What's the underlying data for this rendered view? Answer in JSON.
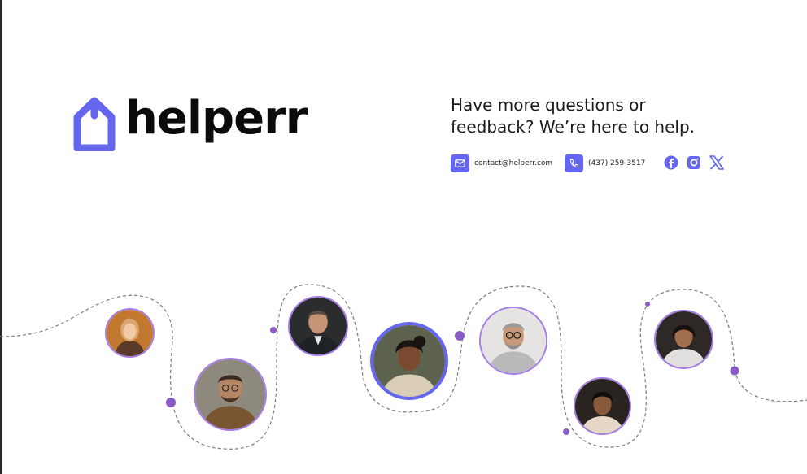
{
  "brand": {
    "name": "helperr",
    "color": "#6466f0"
  },
  "contact": {
    "headline": "Have more questions or feedback? We’re here to help.",
    "email": "contact@helperr.com",
    "phone": "(437) 259-3517"
  },
  "icons": {
    "email": "mail-icon",
    "phone": "phone-icon",
    "socials": [
      "facebook-icon",
      "instagram-icon",
      "x-icon"
    ]
  },
  "colors": {
    "accent": "#6466f0",
    "path_dot": "#8a5ac8",
    "avatar_ring": "#a57de6"
  }
}
